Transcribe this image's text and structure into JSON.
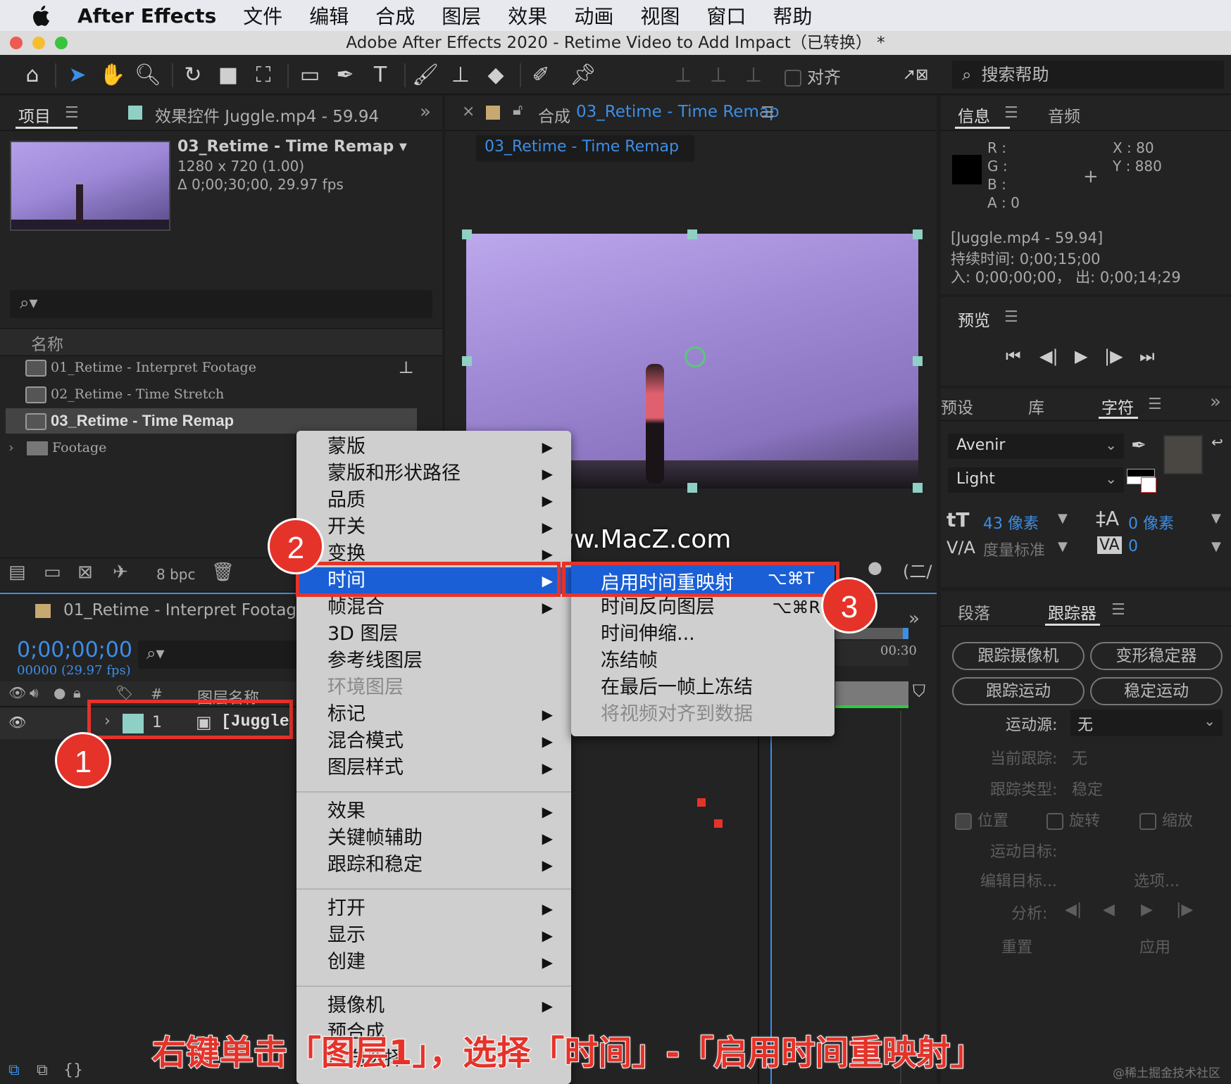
{
  "menubar": {
    "app": "After Effects",
    "items": [
      "文件",
      "编辑",
      "合成",
      "图层",
      "效果",
      "动画",
      "视图",
      "窗口",
      "帮助"
    ]
  },
  "window_title": "Adobe After Effects 2020 - Retime Video to Add Impact（已转换） *",
  "toolbar": {
    "align_label": "对齐",
    "search_placeholder": "搜索帮助"
  },
  "project_panel": {
    "tab_project": "项目",
    "tab_effects": "效果控件 Juggle.mp4 - 59.94",
    "comp_name": "03_Retime - Time Remap ▾",
    "comp_size": "1280 x 720 (1.00)",
    "comp_duration": "Δ 0;00;30;00, 29.97 fps",
    "search_icon": "search-icon",
    "col_name": "名称",
    "items": [
      "01_Retime - Interpret Footage",
      "02_Retime - Time Stretch",
      "03_Retime - Time Remap",
      "Footage"
    ],
    "bpc": "8 bpc"
  },
  "comp_panel": {
    "close": "×",
    "tab_prefix": "合成",
    "tab_name": "03_Retime - Time Remap",
    "subtab": "03_Retime - Time Remap"
  },
  "watermark": "www.MacZ.com",
  "timeline": {
    "comp_tab": "01_Retime - Interpret Footage",
    "timecode": "0;00;00;00",
    "fps": "00000 (29.97 fps)",
    "col_num": "#",
    "col_layer": "图层名称",
    "layer_num": "1",
    "layer_name": "[Juggle",
    "time_end": "00:30"
  },
  "info_panel": {
    "tab_info": "信息",
    "tab_audio": "音频",
    "r": "R :",
    "g": "G :",
    "b": "B :",
    "a": "A :  0",
    "x": "X : 80",
    "y": "Y : 880",
    "source": "[Juggle.mp4 - 59.94]",
    "duration": "持续时间: 0;00;15;00",
    "inout": "入: 0;00;00;00， 出: 0;00;14;29"
  },
  "preview_panel": {
    "title": "预览"
  },
  "char_panel": {
    "tab_presets": "预设",
    "tab_library": "库",
    "tab_char": "字符",
    "font": "Avenir",
    "style": "Light",
    "size": "43 像素",
    "leading": "0 像素",
    "kerning": "度量标准",
    "tracking": "0"
  },
  "tracker_panel": {
    "tab_para": "段落",
    "tab_tracker": "跟踪器",
    "btn_cam": "跟踪摄像机",
    "btn_warp": "变形稳定器",
    "btn_motion": "跟踪运动",
    "btn_stab": "稳定运动",
    "source_label": "运动源:",
    "source_value": "无",
    "current_label": "当前跟踪:",
    "current_value": "无",
    "type_label": "跟踪类型:",
    "type_value": "稳定",
    "chk_pos": "位置",
    "chk_rot": "旋转",
    "chk_scale": "缩放",
    "target_label": "运动目标:",
    "edit_target": "编辑目标...",
    "options": "选项...",
    "analyze": "分析:",
    "reset": "重置",
    "apply": "应用"
  },
  "context_menu": {
    "items": [
      "蒙版",
      "蒙版和形状路径",
      "品质",
      "开关",
      "变换",
      "时间",
      "帧混合",
      "3D 图层",
      "参考线图层",
      "环境图层",
      "标记",
      "混合模式",
      "图层样式",
      "效果",
      "关键帧辅助",
      "跟踪和稳定",
      "打开",
      "显示",
      "创建",
      "摄像机",
      "预合成",
      "反向选择"
    ]
  },
  "submenu": {
    "items": [
      {
        "label": "启用时间重映射",
        "shortcut": "⌥⌘T"
      },
      {
        "label": "时间反向图层",
        "shortcut": "⌥⌘R"
      },
      {
        "label": "时间伸缩...",
        "shortcut": ""
      },
      {
        "label": "冻结帧",
        "shortcut": ""
      },
      {
        "label": "在最后一帧上冻结",
        "shortcut": ""
      },
      {
        "label": "将视频对齐到数据",
        "shortcut": ""
      }
    ]
  },
  "badges": [
    "1",
    "2",
    "3"
  ],
  "caption": "右键单击「图层1」，选择「时间」-「启用时间重映射」",
  "credit": "@稀土掘金技术社区",
  "colors": {
    "accent_blue": "#1a5fd6",
    "highlight_red": "#e5332a",
    "link_blue": "#3d8ee6",
    "caption_red": "#e5332a"
  }
}
